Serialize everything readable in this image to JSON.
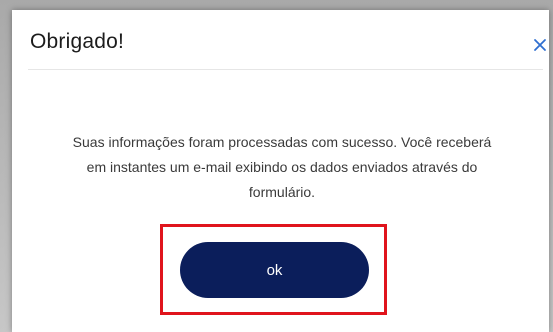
{
  "dialog": {
    "title": "Obrigado!",
    "close_icon": "close-icon",
    "message": "Suas informações foram processadas com sucesso. Você receberá em instantes um e-mail exibindo os dados enviados através do formulário.",
    "ok_label": "ok"
  },
  "colors": {
    "button_bg": "#0b1e5b",
    "close_icon": "#2f6fd0",
    "highlight": "#e0141c"
  }
}
